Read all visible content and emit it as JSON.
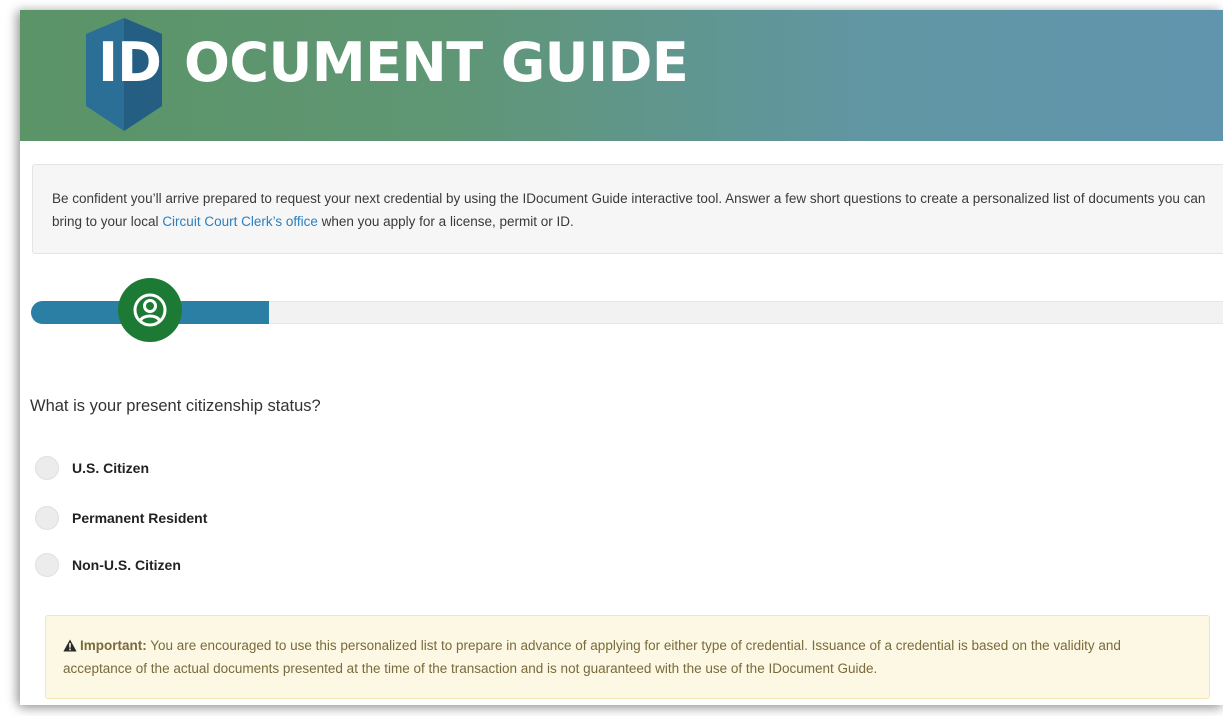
{
  "header": {
    "logo_id": "ID",
    "logo_rest": "OCUMENT GUIDE",
    "background_colors": [
      "#5b9467",
      "#6195ae"
    ],
    "shield_color": "#2b6e96"
  },
  "intro": {
    "text_before_link": "Be confident you’ll arrive prepared to request your next credential by using the IDocument Guide interactive tool. Answer a few short questions to create a personalized list of documents you can bring to your local ",
    "link_text": "Circuit Court Clerk’s office",
    "text_after_link": " when you apply for a license, permit or ID."
  },
  "progress": {
    "percent": 19.7,
    "icon": "user-circle-icon",
    "fill_color": "#2b7fa5",
    "knob_color": "#1d7a34"
  },
  "question": {
    "text": "What is your present citizenship status?",
    "options": [
      {
        "label": "U.S. Citizen"
      },
      {
        "label": "Permanent Resident"
      },
      {
        "label": "Non-U.S. Citizen"
      }
    ]
  },
  "alert": {
    "icon": "warning-icon",
    "label": "Important:",
    "text": " You are encouraged to use this personalized list to prepare in advance of applying for either type of credential. Issuance of a credential is based on the validity and acceptance of the actual documents presented at the time of the transaction and is not guaranteed with the use of the IDocument Guide."
  }
}
